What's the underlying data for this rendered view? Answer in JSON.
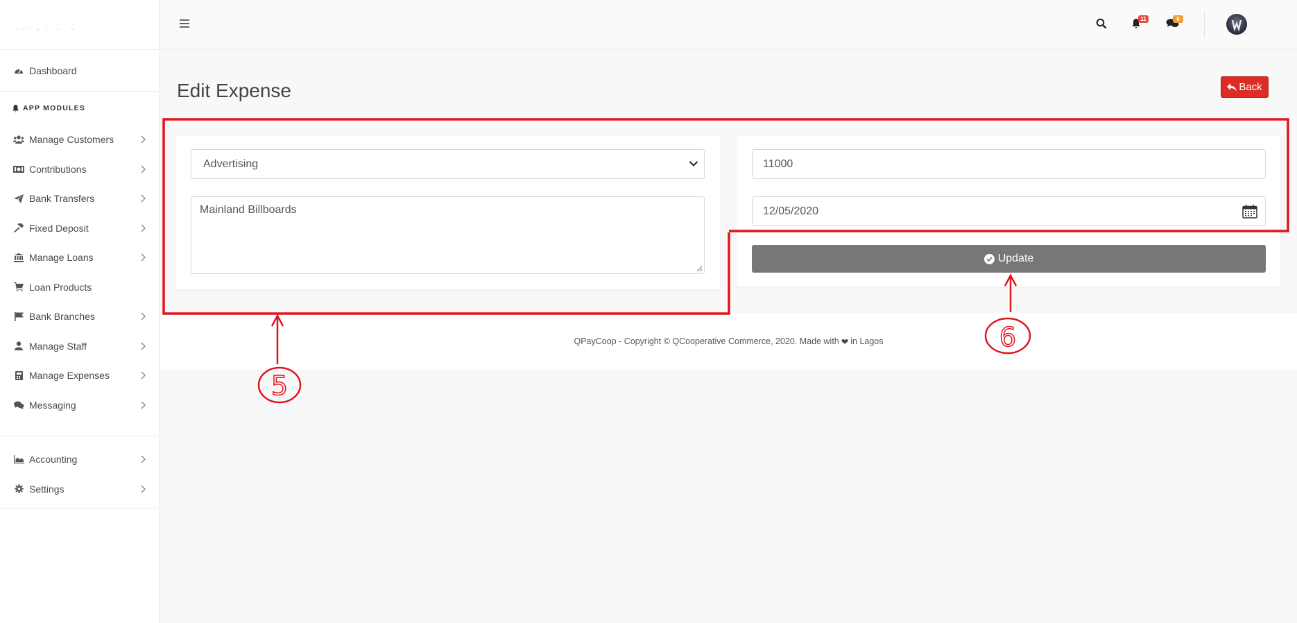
{
  "sidebar": {
    "dashboard": "Dashboard",
    "section_title": "APP MODULES",
    "items": [
      {
        "label": "Manage Customers",
        "icon": "users-icon",
        "chevron": true
      },
      {
        "label": "Contributions",
        "icon": "money-icon",
        "chevron": true
      },
      {
        "label": "Bank Transfers",
        "icon": "paper-plane-icon",
        "chevron": true
      },
      {
        "label": "Fixed Deposit",
        "icon": "gavel-icon",
        "chevron": true
      },
      {
        "label": "Manage Loans",
        "icon": "bank-icon",
        "chevron": true
      },
      {
        "label": "Loan Products",
        "icon": "cart-icon",
        "chevron": false
      },
      {
        "label": "Bank Branches",
        "icon": "flag-icon",
        "chevron": true
      },
      {
        "label": "Manage Staff",
        "icon": "user-icon",
        "chevron": true
      },
      {
        "label": "Manage Expenses",
        "icon": "calculator-icon",
        "chevron": true
      },
      {
        "label": "Messaging",
        "icon": "comments-icon",
        "chevron": true
      }
    ],
    "bottom_items": [
      {
        "label": "Accounting",
        "icon": "area-chart-icon",
        "chevron": true
      },
      {
        "label": "Settings",
        "icon": "cog-icon",
        "chevron": true
      }
    ]
  },
  "topbar": {
    "notifications_count": "11",
    "messages_count": "0"
  },
  "page": {
    "title": "Edit Expense",
    "back_label": "Back"
  },
  "form": {
    "category": "Advertising",
    "description": "Mainland Billboards",
    "amount": "11000",
    "date": "12/05/2020",
    "update_label": "Update"
  },
  "footer": {
    "text_before": "QPayCoop - Copyright © QCooperative Commerce, 2020. Made with",
    "text_after": "in Lagos"
  },
  "annotations": {
    "label_5": "5",
    "label_6": "6"
  },
  "colors": {
    "annotation": "#e0141c",
    "back_button": "#dd2c25",
    "update_button": "#777777"
  }
}
